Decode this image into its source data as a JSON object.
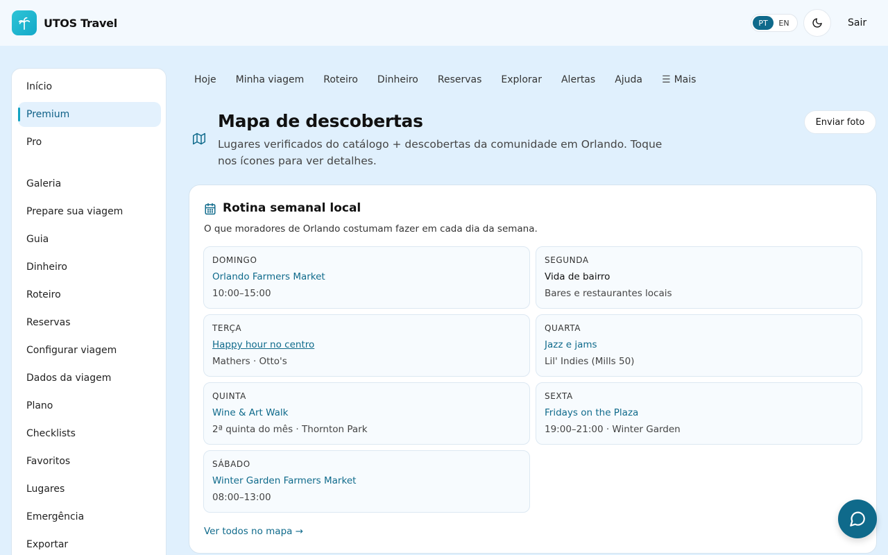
{
  "header": {
    "brand_name": "UTOS Travel",
    "lang_options": [
      "PT",
      "EN"
    ],
    "lang_selected": "PT",
    "logout_label": "Sair",
    "icons": {
      "logo": "palm-tree-icon",
      "theme": "moon-icon"
    }
  },
  "sidebar": {
    "items": [
      {
        "label": "Início"
      },
      {
        "label": "Premium",
        "active": true
      },
      {
        "label": "Pro"
      },
      {
        "label": "Galeria"
      },
      {
        "label": "Prepare sua viagem"
      },
      {
        "label": "Guia"
      },
      {
        "label": "Dinheiro"
      },
      {
        "label": "Roteiro"
      },
      {
        "label": "Reservas"
      },
      {
        "label": "Configurar viagem"
      },
      {
        "label": "Dados da viagem"
      },
      {
        "label": "Plano"
      },
      {
        "label": "Checklists"
      },
      {
        "label": "Favoritos"
      },
      {
        "label": "Lugares"
      },
      {
        "label": "Emergência"
      },
      {
        "label": "Exportar"
      }
    ]
  },
  "nav": {
    "items": [
      "Hoje",
      "Minha viagem",
      "Roteiro",
      "Dinheiro",
      "Reservas",
      "Explorar",
      "Alertas",
      "Ajuda"
    ],
    "more_label": "Mais"
  },
  "page": {
    "title": "Mapa de descobertas",
    "subtitle": "Lugares verificados do catálogo + descobertas da comunidade em Orlando. Toque nos ícones para ver detalhes.",
    "upload_label": "Enviar foto"
  },
  "routine": {
    "title": "Rotina semanal local",
    "description": "O que moradores de Orlando costumam fazer em cada dia da semana.",
    "days": [
      {
        "day": "DOMINGO",
        "event": "Orlando Farmers Market",
        "detail": "10:00–15:00",
        "style": "link"
      },
      {
        "day": "SEGUNDA",
        "event": "Vida de bairro",
        "detail": "Bares e restaurantes locais",
        "style": "plain"
      },
      {
        "day": "TERÇA",
        "event": "Happy hour no centro",
        "detail": "Mathers · Otto's",
        "style": "underline"
      },
      {
        "day": "QUARTA",
        "event": "Jazz e jams",
        "detail": "Lil' Indies (Mills 50)",
        "style": "link"
      },
      {
        "day": "QUINTA",
        "event": "Wine & Art Walk",
        "detail": "2ª quinta do mês · Thornton Park",
        "style": "link"
      },
      {
        "day": "SEXTA",
        "event": "Fridays on the Plaza",
        "detail": "19:00–21:00 · Winter Garden",
        "style": "link"
      },
      {
        "day": "SÁBADO",
        "event": "Winter Garden Farmers Market",
        "detail": "08:00–13:00",
        "style": "link"
      }
    ],
    "see_all_label": "Ver todos no mapa →"
  },
  "colors": {
    "accent": "#0f6a8b",
    "brand": "#1ab7cf",
    "background": "#e0f0fd"
  }
}
